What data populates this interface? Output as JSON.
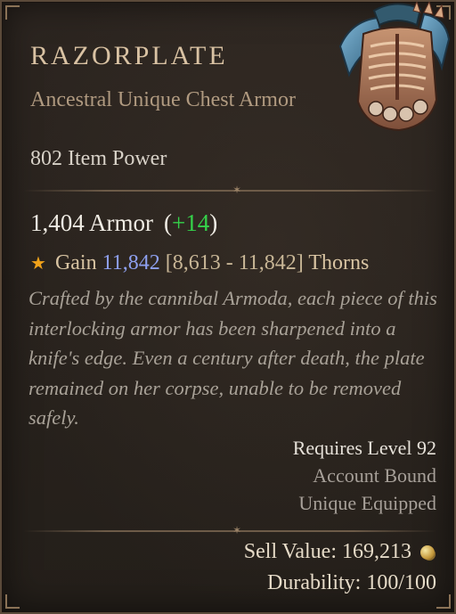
{
  "item": {
    "name": "RAZORPLATE",
    "type": "Ancestral Unique Chest Armor",
    "item_power": "802 Item Power",
    "armor_value": "1,404 Armor",
    "armor_delta": "+14",
    "affix": {
      "prefix": "Gain",
      "value": "11,842",
      "range": "[8,613 - 11,842]",
      "stat": "Thorns"
    },
    "flavor_text": "Crafted by the cannibal Armoda, each piece of this interlocking armor has been sharpened into a knife's edge. Even a century after death, the plate remained on her corpse, unable to be removed safely.",
    "requires_level": "Requires Level 92",
    "account_bound": "Account Bound",
    "unique_equipped": "Unique Equipped",
    "sell_value": "Sell Value: 169,213",
    "durability": "Durability: 100/100"
  },
  "colors": {
    "title": "#d9c2a3",
    "subtitle": "#b09a80",
    "delta_green": "#35d24a",
    "affix_blue": "#8ea0f0",
    "star_gold": "#f0a21a"
  },
  "icons": {
    "item_art": "chest-armor-icon",
    "affix": "star-icon",
    "currency": "gold-coin-icon"
  }
}
